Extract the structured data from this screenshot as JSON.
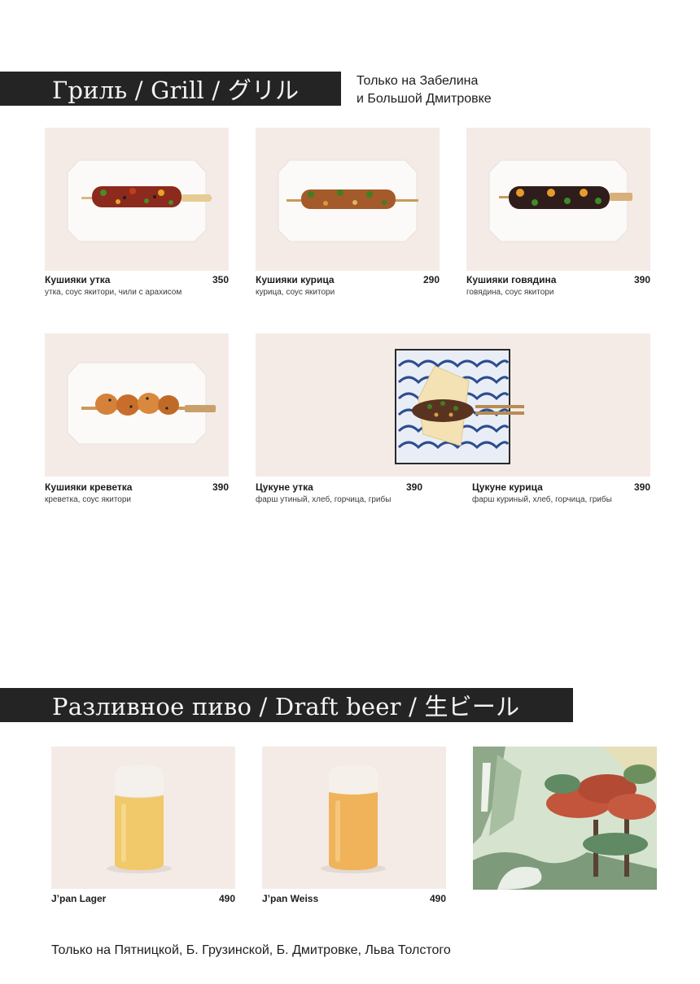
{
  "grill": {
    "heading": "Гриль / Grill / グリル",
    "availability_line1": "Только на Забелина",
    "availability_line2": "и Большой Дмитровке",
    "items": [
      {
        "name": "Кушияки утка",
        "price": "350",
        "description": "утка, соус якитори, чили с арахисом"
      },
      {
        "name": "Кушияки курица",
        "price": "290",
        "description": "курица, соус якитори"
      },
      {
        "name": "Кушияки говядина",
        "price": "390",
        "description": "говядина, соус якитори"
      },
      {
        "name": "Кушияки креветка",
        "price": "390",
        "description": "креветка, соус якитори"
      },
      {
        "name": "Цукуне утка",
        "price": "390",
        "description": "фарш утиный, хлеб, горчица, грибы"
      },
      {
        "name": "Цукуне курица",
        "price": "390",
        "description": "фарш куриный, хлеб, горчица, грибы"
      }
    ]
  },
  "beer": {
    "heading": "Разливное пиво / Draft beer / 生ビール",
    "items": [
      {
        "name": "J’pan Lager",
        "price": "490"
      },
      {
        "name": "J’pan Weiss",
        "price": "490"
      }
    ],
    "availability": "Только на Пятницкой, Б. Грузинской, Б. Дмитровке, Льва Толстого"
  },
  "colors": {
    "banner_background": "#242424",
    "photo_background": "#f4ebe7",
    "text": "#1d1d1d"
  }
}
